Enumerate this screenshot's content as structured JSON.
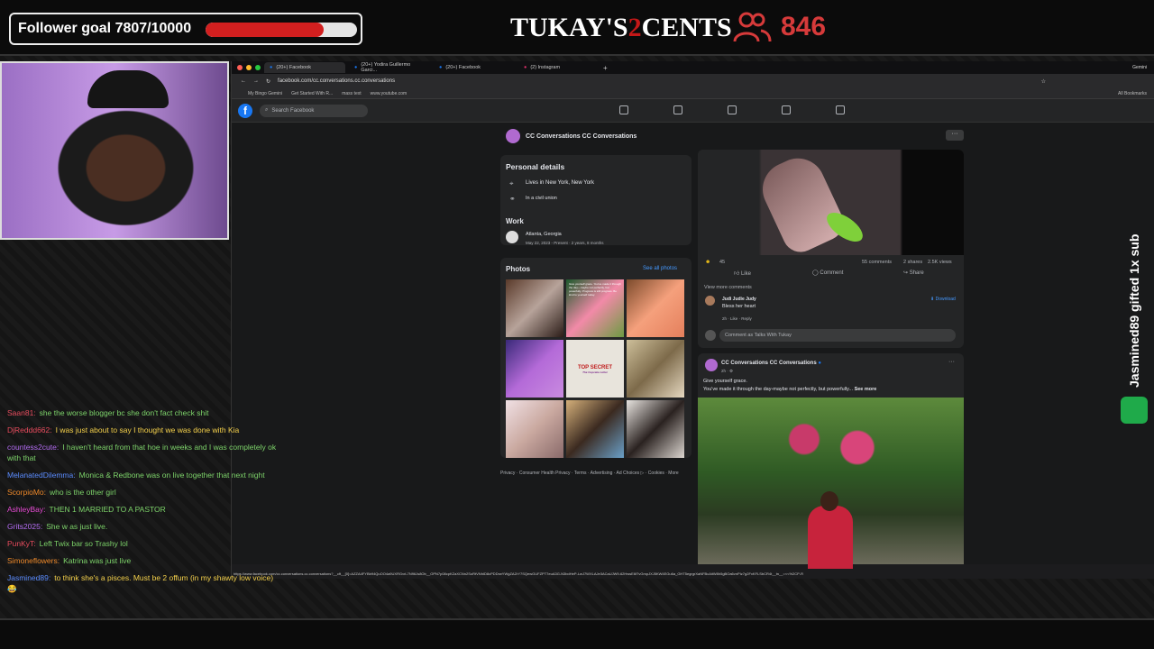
{
  "overlay": {
    "follower_label": "Follower goal 7807/10000",
    "follower_progress": 0.7807,
    "brand_prefix": "TUKAY'S",
    "brand_two": "2",
    "brand_suffix": "CENTS",
    "viewer_count": "846",
    "sub_alert": "Jasmined89 gifted 1x sub"
  },
  "chat": [
    {
      "user": "Saan81:",
      "user_color": "#e74b5d",
      "text": "she the worse blogger bc she don't fact check shit",
      "text_color": "#7dd36a"
    },
    {
      "user": "DjReddd662:",
      "user_color": "#e74b5d",
      "text": "I was just about to say I thought we was done with Kia",
      "text_color": "#f5d14b"
    },
    {
      "user": "countess2cute:",
      "user_color": "#b36cf2",
      "text": "I haven't heard from that hoe in weeks and I was completely ok with that",
      "text_color": "#7dd36a"
    },
    {
      "user": "MelanatedDilemma:",
      "user_color": "#5b8cff",
      "text": "Monica & Redbone was on live together that next night",
      "text_color": "#7dd36a"
    },
    {
      "user": "ScorpioMo:",
      "user_color": "#f08a2a",
      "text": "who is the other girl",
      "text_color": "#7dd36a"
    },
    {
      "user": "AshleyBay:",
      "user_color": "#e74bd4",
      "text": "THEN 1 MARRIED TO A PASTOR",
      "text_color": "#7dd36a"
    },
    {
      "user": "Grits2025:",
      "user_color": "#b36cf2",
      "text": "She w as just live.",
      "text_color": "#7dd36a"
    },
    {
      "user": "PunKyT:",
      "user_color": "#e74b5d",
      "text": "Left Twix bar so Trashy lol",
      "text_color": "#7dd36a"
    },
    {
      "user": "Simoneflowers:",
      "user_color": "#f08a2a",
      "text": "Katrina was just live",
      "text_color": "#7dd36a"
    },
    {
      "user": "Jasmined89:",
      "user_color": "#5b8cff",
      "text": "to think she's a pisces. Must be 2 offum (in my shawty low voice) 😂",
      "text_color": "#f5d14b"
    }
  ],
  "browser": {
    "tabs": [
      "(20+) Facebook",
      "(20+) Yodira Guillermo Garci...",
      "(20+) Facebook",
      "(2) Instagram"
    ],
    "address": "facebook.com/cc.conversations.cc.conversations",
    "bookmarks": [
      "My Bingo Gemini",
      "Get Started With R...",
      "mass text",
      "www.youtube.com"
    ],
    "all_bookmarks": "All Bookmarks",
    "gemini": "Gemini",
    "status_url": "https://www.facebook.com/cc.conversations.cc.conversations?__cft__[0]=AZZA4FYBb94QuOO4a9UXRGvrL7N96Js8Ob__OPN7p08cpKZaXCNn2SoRtVNhID8cPDDrwYWgZAZrY7SQewGUFZPT7euA3G-N3bdHeP-LwJ7WXLAJe3ACaUJW9-62HwsE6f7vGmpJXJ5KW4EGu6a_GHT5egrgrXaNFBcAitW8h5gBOa6vnPIz7g2FxKFLSbCR4t__tn__=<<%2CP-R"
  },
  "facebook": {
    "search_placeholder": "Search Facebook",
    "page_name": "CC Conversations CC Conversations",
    "personal_details_title": "Personal details",
    "lives_in": "Lives in New York, New York",
    "relationship": "In a civil union",
    "work_title": "Work",
    "work_place": "Atlanta, Georgia",
    "work_dates": "May 22, 2023 - Present · 2 years, 8 months",
    "photos_title": "Photos",
    "see_all_photos": "See all photos",
    "photo_text_1": "Give yourself grace. You've made it through the day—maybe not perfectly, but powerfully. Progress is still progress. Be kind to yourself today.",
    "photo_text_2": "TOP SECRET",
    "photo_text_3": "The Cupcake Letter",
    "footer_links": "Privacy · Consumer Health Privacy · Terms · Advertising · Ad Choices ▷ · Cookies · More",
    "post1": {
      "reactions": "45",
      "comments": "55 comments",
      "shares": "2 shares",
      "views": "2.5K views",
      "like": "Like",
      "comment": "Comment",
      "share": "Share",
      "view_more": "View more comments",
      "commenter": "Judi Judie Judy",
      "comment_text": "Bless her heart",
      "comment_meta": "2h · Like · Reply",
      "download": "Download",
      "comment_as": "Comment as Talks With Tukay"
    },
    "post2": {
      "author": "CC Conversations CC Conversations",
      "time": "2h · ⚙",
      "line1": "Give yourself grace.",
      "line2": "You've made it through the day-maybe not perfectly, but powerfully...",
      "see_more": "See more"
    }
  }
}
